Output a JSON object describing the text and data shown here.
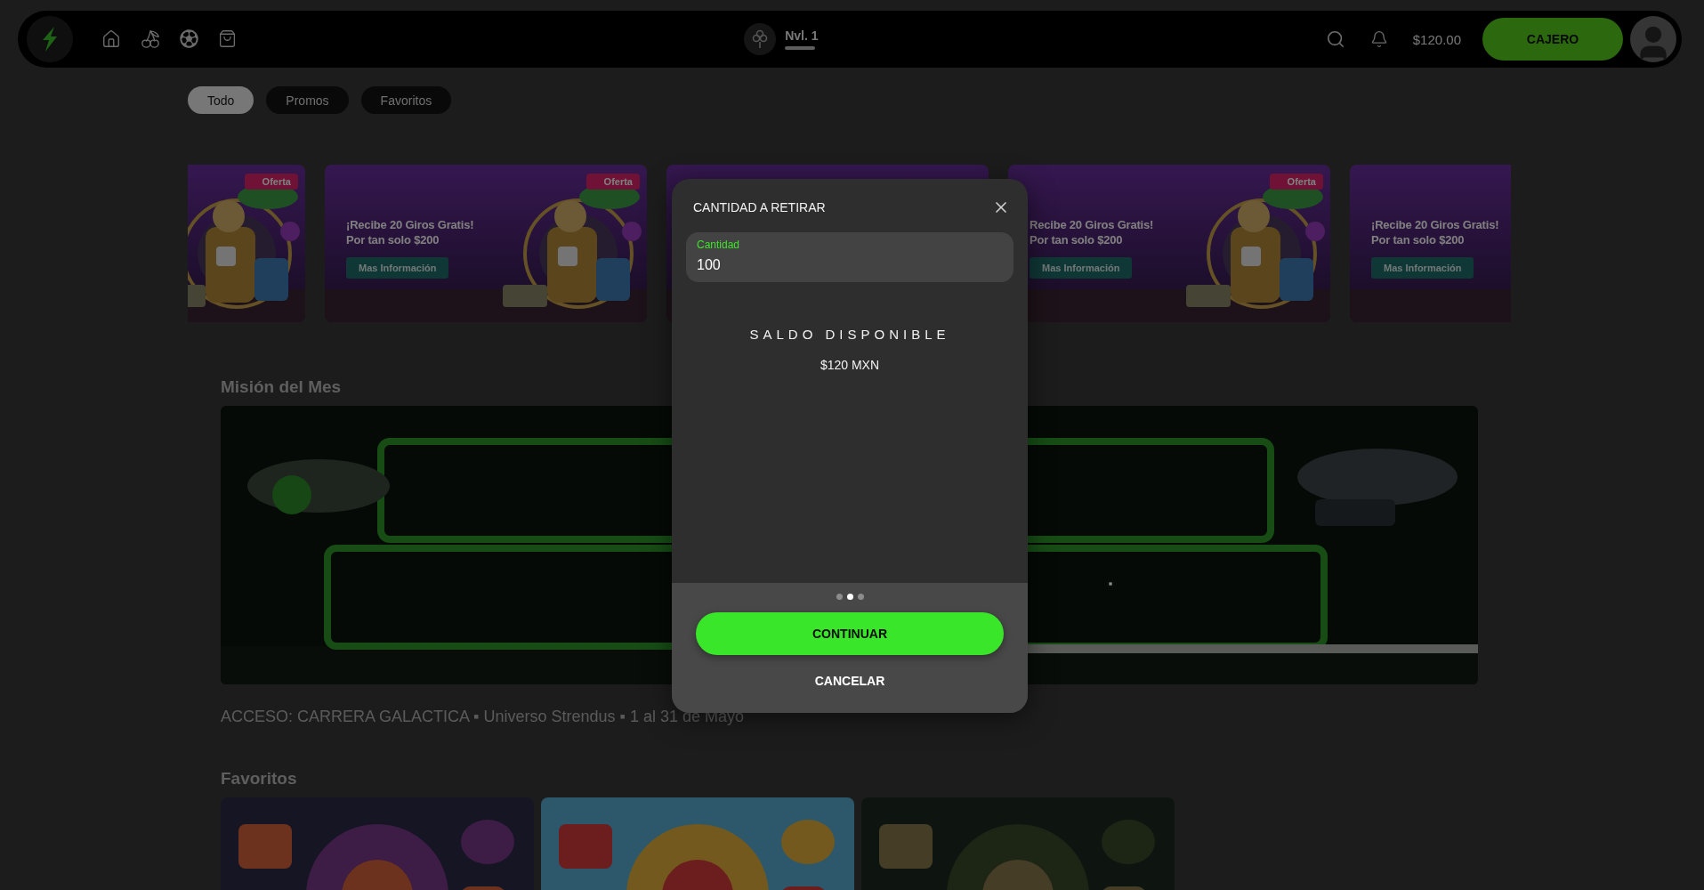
{
  "header": {
    "level_label": "Nvl. 1",
    "balance": "$120.00",
    "cashier_button": "CAJERO"
  },
  "filters": [
    {
      "label": "Todo",
      "selected": true
    },
    {
      "label": "Promos",
      "selected": false
    },
    {
      "label": "Favoritos",
      "selected": false
    }
  ],
  "banners": [
    {
      "kind": "picture",
      "badge": "Oferta"
    },
    {
      "kind": "picture",
      "headline": "¡Recibe 20 Giros Gratis!",
      "subline": "Por tan solo $200",
      "button": "Mas Información",
      "badge": "Oferta"
    },
    {
      "kind": "picture"
    },
    {
      "kind": "picture",
      "headline": "Recibe 20 Giros Gratis!",
      "subline": "Por tan solo $200",
      "button": "Mas Información",
      "badge": "Oferta"
    },
    {
      "kind": "picture",
      "headline": "¡Recibe 20 Giros Gratis!",
      "subline": "Por tan solo $200",
      "button": "Mas Información"
    }
  ],
  "mission": {
    "title": "Misión del Mes",
    "caption": "ACCESO: CARRERA GALACTICA ▪ Universo Strendus ▪ 1 al 31 de Mayo"
  },
  "favorites": {
    "title": "Favoritos",
    "tiles": [
      {
        "kind": "picture"
      },
      {
        "kind": "picture"
      },
      {
        "kind": "picture"
      }
    ]
  },
  "dialog": {
    "title": "CANTIDAD A RETIRAR",
    "field": {
      "label": "Cantidad",
      "value": "100"
    },
    "balance_label": "SALDO DISPONIBLE",
    "balance_value": "$120 MXN",
    "dots": [
      {
        "selected": false
      },
      {
        "selected": true
      },
      {
        "selected": false
      }
    ],
    "primary_button": "CONTINUAR",
    "secondary_button": "CANCELAR"
  }
}
